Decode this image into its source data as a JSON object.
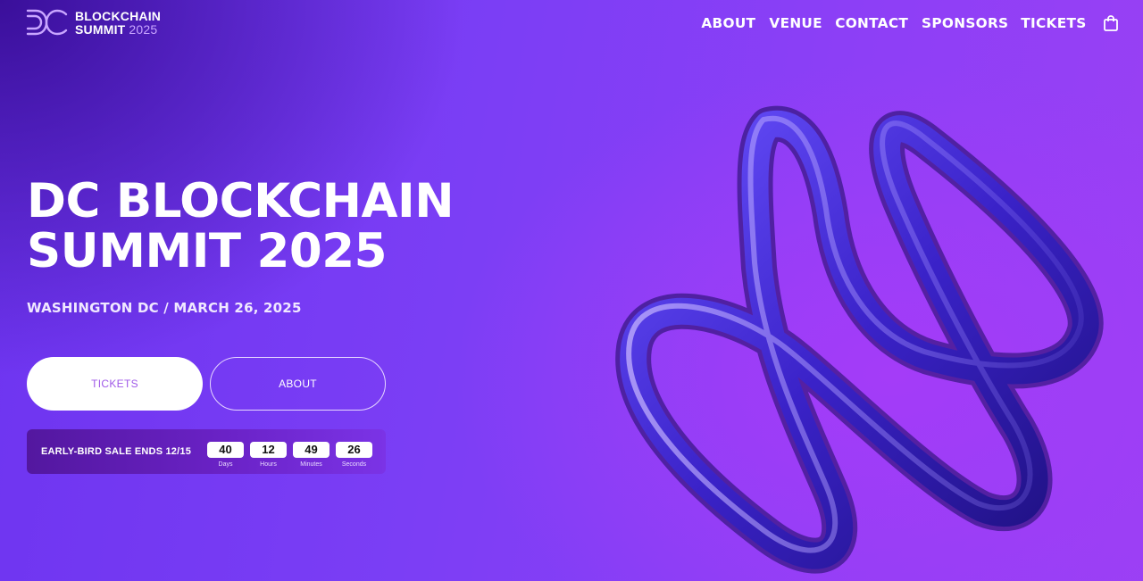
{
  "brand": {
    "line1": "BLOCKCHAIN",
    "line2": "SUMMIT",
    "year": "2025"
  },
  "nav": {
    "items": [
      {
        "label": "ABOUT"
      },
      {
        "label": "VENUE"
      },
      {
        "label": "CONTACT"
      },
      {
        "label": "SPONSORS"
      },
      {
        "label": "TICKETS"
      }
    ],
    "cart_icon": "shopping-bag-icon"
  },
  "hero": {
    "title_line1": "DC BLOCKCHAIN",
    "title_line2": "SUMMIT 2025",
    "subtitle": "WASHINGTON DC / MARCH 26, 2025",
    "primary_button": "TICKETS",
    "secondary_button": "ABOUT"
  },
  "countdown": {
    "label": "EARLY-BIRD SALE ENDS 12/15",
    "units": [
      {
        "value": "40",
        "label": "Days"
      },
      {
        "value": "12",
        "label": "Hours"
      },
      {
        "value": "49",
        "label": "Minutes"
      },
      {
        "value": "26",
        "label": "Seconds"
      }
    ]
  },
  "colors": {
    "accent": "#7b3ef5",
    "button_text": "#a05ae8",
    "countdown_bg": "#53179f"
  }
}
